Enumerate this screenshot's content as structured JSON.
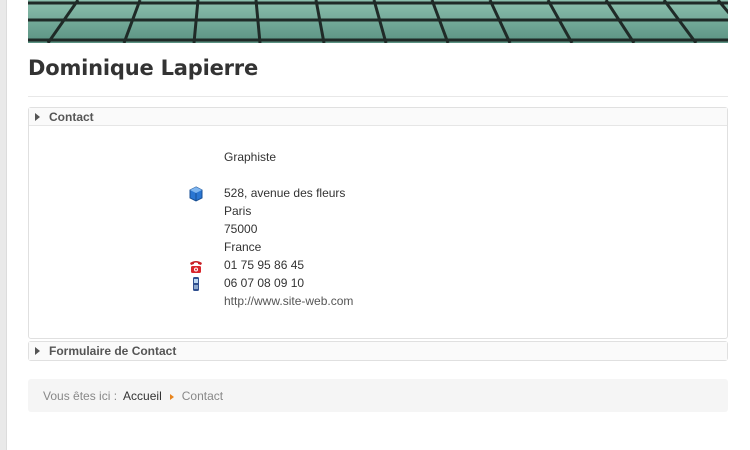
{
  "page": {
    "title": "Dominique Lapierre"
  },
  "contact_panel": {
    "heading": "Contact",
    "position": "Graphiste",
    "address": {
      "street": "528, avenue des fleurs",
      "city": "Paris",
      "postcode": "75000",
      "country": "France"
    },
    "phone": "01 75 95 86 45",
    "mobile": "06 07 08 09 10",
    "website": "http://www.site-web.com",
    "icons": {
      "address": "address-icon",
      "phone": "telephone-icon",
      "mobile": "mobile-phone-icon"
    }
  },
  "form_panel": {
    "heading": "Formulaire de Contact"
  },
  "breadcrumb": {
    "prefix": "Vous êtes ici :",
    "home": "Accueil",
    "current": "Contact"
  },
  "colors": {
    "breadcrumb_separator": "#e8841c",
    "banner": "#6aa08f"
  }
}
